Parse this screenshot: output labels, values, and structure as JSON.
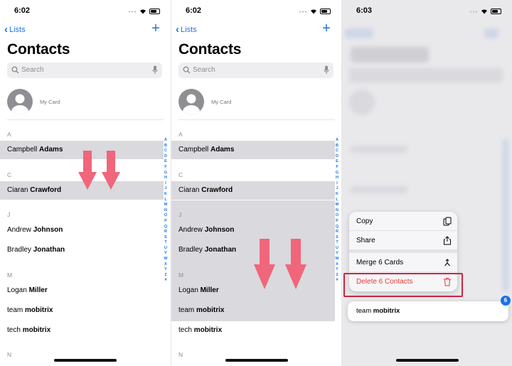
{
  "panels": [
    {
      "time": "6:02",
      "back_label": "Lists",
      "title": "Contacts",
      "search_placeholder": "Search",
      "my_card": "My Card",
      "sections": [
        "A",
        "C",
        "J",
        "M",
        "N"
      ],
      "contacts": [
        {
          "first": "Campbell",
          "last": "Adams",
          "selected": true
        },
        {
          "first": "Ciaran",
          "last": "Crawford",
          "selected": true
        },
        {
          "first": "Andrew",
          "last": "Johnson",
          "selected": false
        },
        {
          "first": "Bradley",
          "last": "Jonathan",
          "selected": false
        },
        {
          "first": "Logan",
          "last": "Miller",
          "selected": false
        },
        {
          "first": "team",
          "last": "mobitrix",
          "selected": false
        },
        {
          "first": "tech",
          "last": "mobitrix",
          "selected": false
        }
      ]
    },
    {
      "time": "6:02",
      "back_label": "Lists",
      "title": "Contacts",
      "search_placeholder": "Search",
      "my_card": "My Card",
      "sections": [
        "A",
        "C",
        "J",
        "M",
        "N"
      ],
      "contacts": [
        {
          "first": "Campbell",
          "last": "Adams",
          "selected": true
        },
        {
          "first": "Ciaran",
          "last": "Crawford",
          "selected": true
        },
        {
          "first": "Andrew",
          "last": "Johnson",
          "selected": true
        },
        {
          "first": "Bradley",
          "last": "Jonathan",
          "selected": true
        },
        {
          "first": "Logan",
          "last": "Miller",
          "selected": true
        },
        {
          "first": "team",
          "last": "mobitrix",
          "selected": true
        },
        {
          "first": "tech",
          "last": "mobitrix",
          "selected": false
        }
      ]
    },
    {
      "time": "6:03",
      "menu": [
        {
          "label": "Copy",
          "icon": "copy-icon"
        },
        {
          "label": "Share",
          "icon": "share-icon"
        },
        {
          "label": "Merge 6 Cards",
          "icon": "merge-icon"
        },
        {
          "label": "Delete 6 Contacts",
          "icon": "trash-icon"
        }
      ],
      "drag_card": {
        "first": "team",
        "last": "mobitrix"
      },
      "badge_count": "6"
    }
  ],
  "index_letters": [
    "A",
    "B",
    "C",
    "D",
    "E",
    "F",
    "G",
    "H",
    "I",
    "J",
    "K",
    "L",
    "M",
    "N",
    "O",
    "P",
    "Q",
    "R",
    "S",
    "T",
    "U",
    "V",
    "W",
    "X",
    "Y",
    "Z",
    "#"
  ],
  "colors": {
    "accent": "#1a73e8",
    "selection": "#d9d9de",
    "arrow": "#f0667a",
    "danger": "#e53935",
    "highlight_box": "#d0233f"
  }
}
